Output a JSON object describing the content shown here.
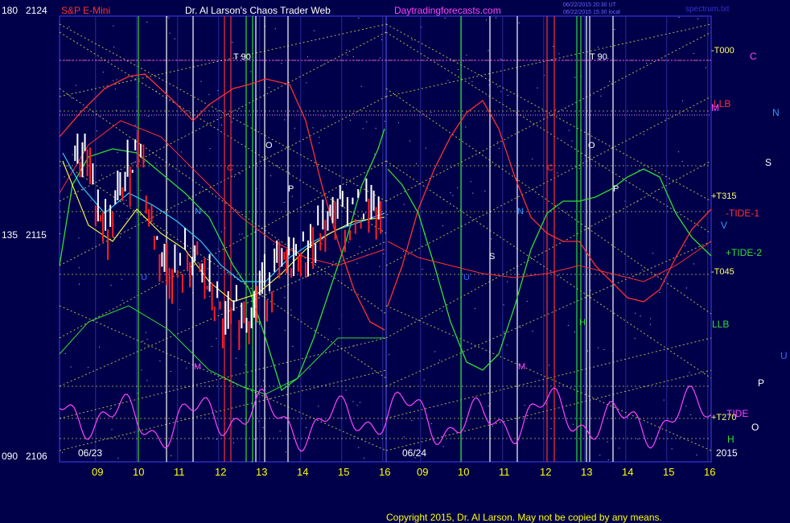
{
  "header": {
    "instrument": "S&P E-Mini",
    "title": "Dr. Al Larson's Chaos Trader Web",
    "site": "Daytradingforecasts.com",
    "note_line1": "06/22/2015 20:30 UT",
    "note_line2": "06/22/2015 15:30 local",
    "file": "spectrum.txt"
  },
  "left_axis": {
    "top": {
      "angle": "180",
      "price": "2124"
    },
    "mid": {
      "angle": "135",
      "price": "2115"
    },
    "bottom": {
      "angle": "090",
      "price": "2106"
    }
  },
  "day_labels": {
    "day1": "06/23",
    "day2": "06/24"
  },
  "x_ticks": [
    "09",
    "10",
    "11",
    "12",
    "13",
    "14",
    "15",
    "16",
    "09",
    "10",
    "11",
    "12",
    "13",
    "14",
    "15",
    "16"
  ],
  "year": "2015",
  "right_labels": [
    {
      "text": "-T000",
      "color": "#ffff66"
    },
    {
      "text": "LLB",
      "color": "#ff3030"
    },
    {
      "text": "+T315",
      "color": "#ffff66"
    },
    {
      "text": "-TIDE-1",
      "color": "#ff3030"
    },
    {
      "text": "+TIDE-2",
      "color": "#33dd33"
    },
    {
      "text": "-T045",
      "color": "#ffff66"
    },
    {
      "text": "LLB",
      "color": "#33dd33"
    },
    {
      "text": "+T270",
      "color": "#ffff66"
    },
    {
      "text": "TIDE",
      "color": "#ff44ff"
    },
    {
      "text": "H",
      "color": "#33dd33"
    }
  ],
  "planet_glyphs": {
    "C": {
      "text": "C",
      "color": "#ff44ff"
    },
    "M_top": {
      "text": "M",
      "color": "#ff44ff"
    },
    "N": {
      "text": "N",
      "color": "#3399ff"
    },
    "S": {
      "text": "S",
      "color": "#ffffff"
    },
    "V": {
      "text": "V",
      "color": "#3399ff"
    },
    "U": {
      "text": "U",
      "color": "#3366ff"
    },
    "P": {
      "text": "P",
      "color": "#ffffff"
    },
    "O": {
      "text": "O",
      "color": "#ffffff"
    }
  },
  "chart_labels": {
    "T90_a": "T 90",
    "T90_b": "T 90",
    "O_a": "O",
    "O_b": "O",
    "P_a": "P",
    "P_b": "P",
    "N_a": "N",
    "N_b": "N",
    "S_b": "S",
    "U_a": "U",
    "U_b": "U",
    "M_a": "M",
    "M_b": "M",
    "H_a": "H",
    "H_b": "H",
    "C_a": "C",
    "C_b": "C"
  },
  "footer": {
    "copyright": "Copyright 2015, Dr. Al Larson. May not be copied by any means."
  },
  "chart_data": {
    "type": "line",
    "title": "Dr. Al Larson's Chaos Trader Web",
    "instrument": "S&P E-Mini",
    "days": [
      "06/23",
      "06/24"
    ],
    "hours": [
      "09",
      "10",
      "11",
      "12",
      "13",
      "14",
      "15",
      "16"
    ],
    "price_axis": {
      "min": 2106,
      "max": 2124,
      "ticks": [
        2106,
        2115,
        2124
      ]
    },
    "angle_axis": {
      "ticks": [
        "090",
        "135",
        "180"
      ]
    },
    "price_series_0623": {
      "hours": [
        8.5,
        8.8,
        9.0,
        9.3,
        9.6,
        9.9,
        10.1,
        10.3,
        10.5,
        10.8,
        11.0,
        11.3,
        11.6,
        11.9,
        12.1,
        12.3,
        12.5,
        12.8,
        13.0,
        13.3,
        13.6,
        14.0,
        14.3,
        14.6,
        14.9,
        15.2,
        15.4,
        15.6,
        15.9,
        16.0
      ],
      "values": [
        2118.8,
        2118.0,
        2116.8,
        2115.2,
        2116.8,
        2118.2,
        2119.2,
        2116.0,
        2114.8,
        2113.8,
        2113.5,
        2114.2,
        2113.6,
        2112.5,
        2111.4,
        2111.6,
        2112.0,
        2112.2,
        2112.9,
        2113.5,
        2113.9,
        2114.4,
        2114.7,
        2115.5,
        2116.3,
        2115.8,
        2116.0,
        2116.4,
        2115.7,
        2115.9
      ]
    },
    "series": [
      {
        "name": "-TIDE-1",
        "color": "#ff3030"
      },
      {
        "name": "+TIDE-2",
        "color": "#33dd33"
      },
      {
        "name": "TIDE",
        "color": "#ff44ff"
      }
    ],
    "reference_lines": [
      "-T000",
      "LLB",
      "+T315",
      "-T045",
      "LLB",
      "+T270"
    ]
  }
}
